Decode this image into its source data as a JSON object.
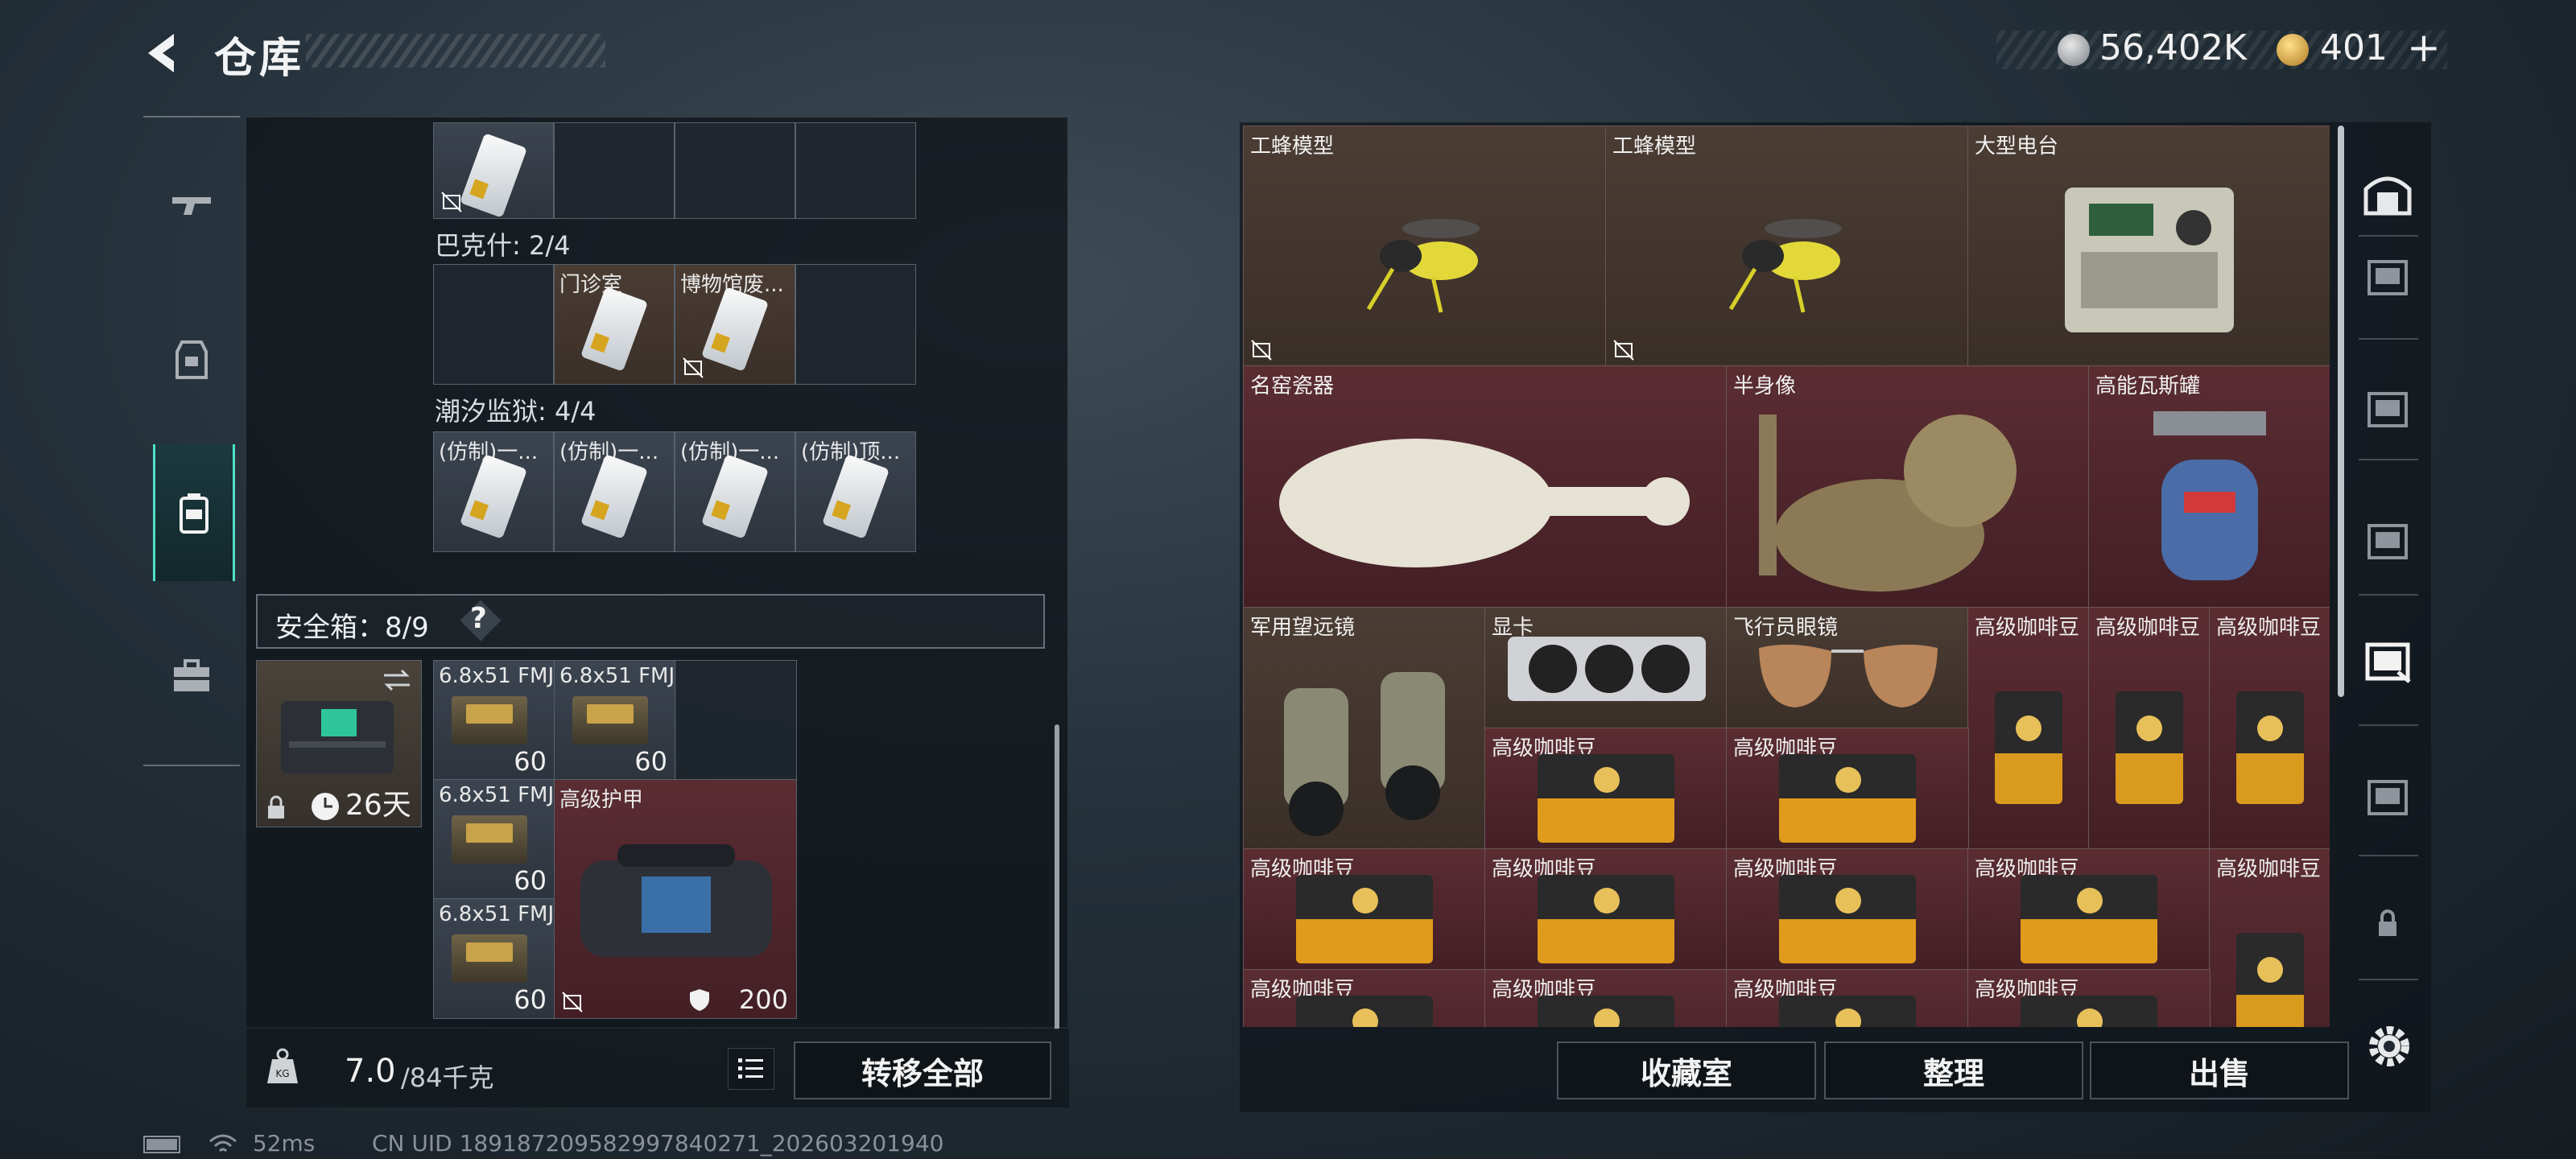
{
  "header": {
    "title": "仓库",
    "silver_value": "56,402K",
    "gold_value": "401",
    "gold_plus": "+"
  },
  "left_nav": {
    "items": [
      "weapon-icon",
      "armor-icon",
      "backpack-icon",
      "toolbox-icon"
    ]
  },
  "inventory": {
    "top_row": {
      "items": [
        {
          "label": ""
        }
      ]
    },
    "sections": [
      {
        "title": "巴克什: 2/4",
        "items": [
          {
            "label": "门诊室"
          },
          {
            "label": "博物馆废..."
          }
        ]
      },
      {
        "title": "潮汐监狱: 4/4",
        "items": [
          {
            "label": "(仿制)一..."
          },
          {
            "label": "(仿制)一..."
          },
          {
            "label": "(仿制)一..."
          },
          {
            "label": "(仿制)顶..."
          }
        ]
      }
    ],
    "safebox": {
      "title": "安全箱：8/9",
      "help": "?",
      "days": "26天"
    },
    "safebox_items": [
      {
        "label": "6.8x51 FMJ",
        "qty": "60"
      },
      {
        "label": "6.8x51 FMJ",
        "qty": "60"
      },
      {
        "label": "6.8x51 FMJ",
        "qty": "60"
      },
      {
        "label": "6.8x51 FMJ",
        "qty": "60"
      },
      {
        "label": "高级护甲",
        "durability": "200"
      }
    ]
  },
  "weight": {
    "value": "7.0",
    "max": "/84千克",
    "icon": "KG"
  },
  "buttons": {
    "transfer_all": "转移全部",
    "collection": "收藏室",
    "sort": "整理",
    "sell": "出售"
  },
  "stash": {
    "items": [
      {
        "label": "工蜂模型"
      },
      {
        "label": "工蜂模型"
      },
      {
        "label": "大型电台"
      },
      {
        "label": "名窑瓷器"
      },
      {
        "label": "半身像"
      },
      {
        "label": "高能瓦斯罐"
      },
      {
        "label": "军用望远镜"
      },
      {
        "label": "显卡"
      },
      {
        "label": "飞行员眼镜"
      },
      {
        "label": "高级咖啡豆"
      },
      {
        "label": "高级咖啡豆"
      },
      {
        "label": "高级咖啡豆"
      },
      {
        "label": "高级咖啡豆"
      },
      {
        "label": "高级咖啡豆"
      },
      {
        "label": "高级咖啡豆"
      },
      {
        "label": "高级咖啡豆"
      },
      {
        "label": "高级咖啡豆"
      },
      {
        "label": "高级咖啡豆"
      },
      {
        "label": "高级咖啡豆"
      },
      {
        "label": "高级咖啡豆"
      },
      {
        "label": "高级咖啡豆"
      },
      {
        "label": "高级咖啡豆"
      },
      {
        "label": "高级咖啡豆"
      }
    ]
  },
  "status": {
    "ping": "52ms",
    "uid": "CN UID 1891872095829978402​71_202603201940"
  },
  "colors": {
    "accent": "#4fe0c8",
    "item_red": "#5a2d33",
    "item_brown": "#4b3d34"
  }
}
